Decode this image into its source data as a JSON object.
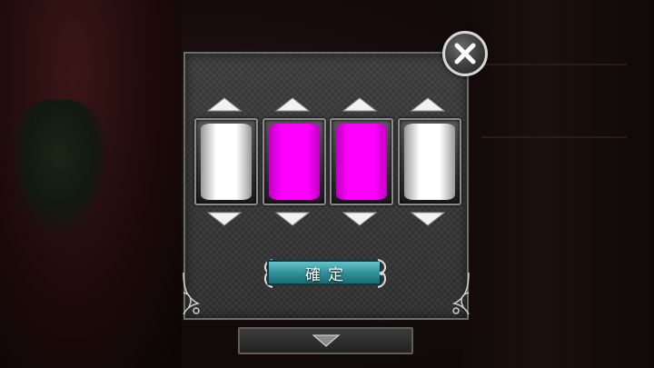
{
  "dialog": {
    "confirm_label": "確定",
    "close_icon": "close-x-icon"
  },
  "reels": [
    {
      "color": "#ffffff",
      "label": "white"
    },
    {
      "color": "#ff00ff",
      "label": "magenta"
    },
    {
      "color": "#ff00ff",
      "label": "magenta"
    },
    {
      "color": "#ffffff",
      "label": "white"
    }
  ],
  "colors": {
    "confirm_button": "#2e8e96",
    "magenta": "#ff00ff",
    "white": "#ffffff"
  }
}
